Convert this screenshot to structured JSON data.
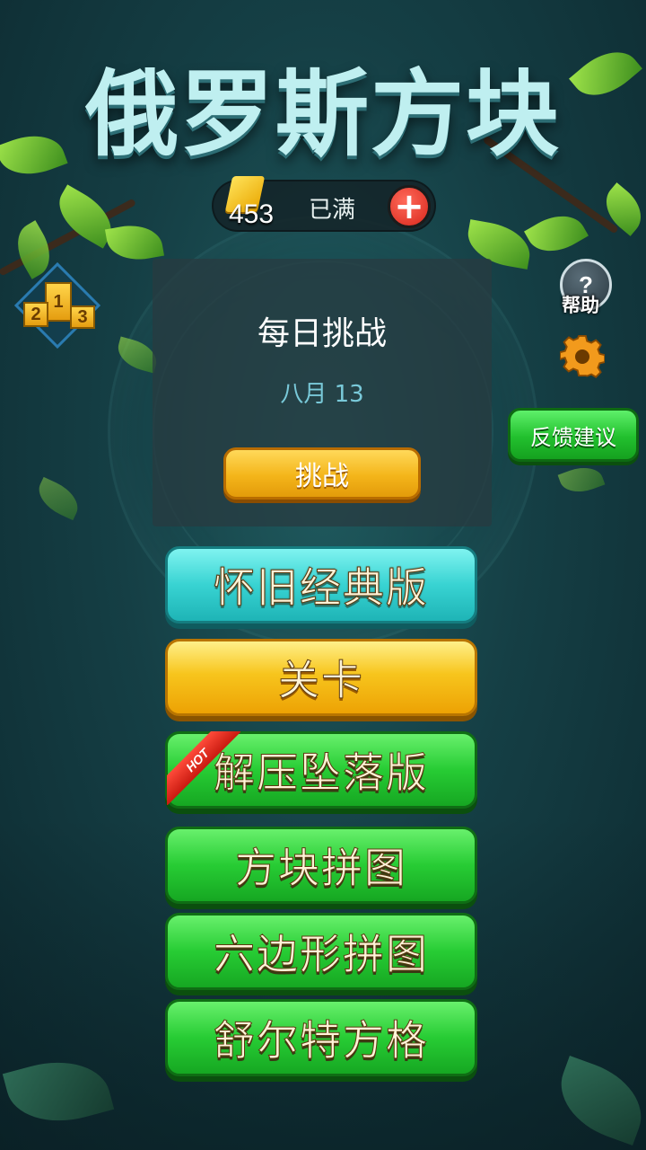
{
  "app": {
    "title": "俄罗斯方块"
  },
  "coins": {
    "count": "453",
    "status": "已满",
    "add_label": "+"
  },
  "sidebar": {
    "help_label": "帮助",
    "help_symbol": "?",
    "feedback_label": "反馈建议",
    "podium_ranks": [
      "1",
      "2",
      "3"
    ]
  },
  "daily": {
    "title": "每日挑战",
    "date": "八月 13",
    "button_label": "挑战"
  },
  "modes": [
    {
      "label": "怀旧经典版",
      "style": "teal"
    },
    {
      "label": "关卡",
      "style": "gold"
    },
    {
      "label": "解压坠落版",
      "style": "green",
      "badge": "HOT"
    },
    {
      "label": "方块拼图",
      "style": "green"
    },
    {
      "label": "六边形拼图",
      "style": "green"
    },
    {
      "label": "舒尔特方格",
      "style": "green"
    }
  ],
  "colors": {
    "teal_button": "#38d3d2",
    "gold_button": "#f7c51d",
    "green_button": "#27cc34",
    "hot_badge": "#e52a1c",
    "background": "#153f45"
  },
  "icons": [
    "coin-icon",
    "plus-icon",
    "podium-icon",
    "help-icon",
    "gear-icon"
  ]
}
